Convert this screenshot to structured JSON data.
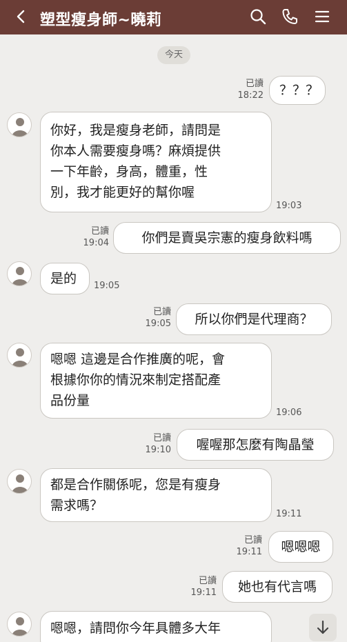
{
  "header": {
    "title": "塑型瘦身師~曉莉",
    "icons": [
      "back-icon",
      "search-icon",
      "phone-icon",
      "menu-icon"
    ],
    "background_color": "#6b3d36"
  },
  "date_divider": "今天",
  "messages": [
    {
      "side": "sent",
      "lines": [
        "？？？"
      ],
      "read": "已讀",
      "time": "18:22"
    },
    {
      "side": "received",
      "lines": [
        "你好，我是瘦身老師，請問是",
        "你本人需要瘦身嗎？麻煩提供",
        "一下年齡，身高，體重，性",
        "別，我才能更好的幫你喔"
      ],
      "time": "19:03"
    },
    {
      "side": "sent",
      "lines": [
        "你們是賣吳宗憲的瘦身飲料嗎"
      ],
      "read": "已讀",
      "time": "19:04"
    },
    {
      "side": "received",
      "lines": [
        "是的"
      ],
      "time": "19:05"
    },
    {
      "side": "sent",
      "lines": [
        "所以你們是代理商？"
      ],
      "read": "已讀",
      "time": "19:05"
    },
    {
      "side": "received",
      "lines": [
        "嗯嗯  這邊是合作推廣的呢，會",
        "根據你你的情況來制定搭配產",
        "品份量"
      ],
      "time": "19:06"
    },
    {
      "side": "sent",
      "lines": [
        "喔喔那怎麼有陶晶瑩"
      ],
      "read": "已讀",
      "time": "19:10"
    },
    {
      "side": "received",
      "lines": [
        "都是合作關係呢，您是有瘦身",
        "需求嗎？"
      ],
      "time": "19:11"
    },
    {
      "side": "sent",
      "lines": [
        "嗯嗯嗯"
      ],
      "read": "已讀",
      "time": "19:11"
    },
    {
      "side": "sent",
      "lines": [
        "她也有代言嗎"
      ],
      "read": "已讀",
      "time": "19:11"
    },
    {
      "side": "received",
      "lines": [
        "嗯嗯，請問你今年具體多大年"
      ],
      "time": ""
    }
  ],
  "scroll_button_icon": "arrow-down-icon"
}
